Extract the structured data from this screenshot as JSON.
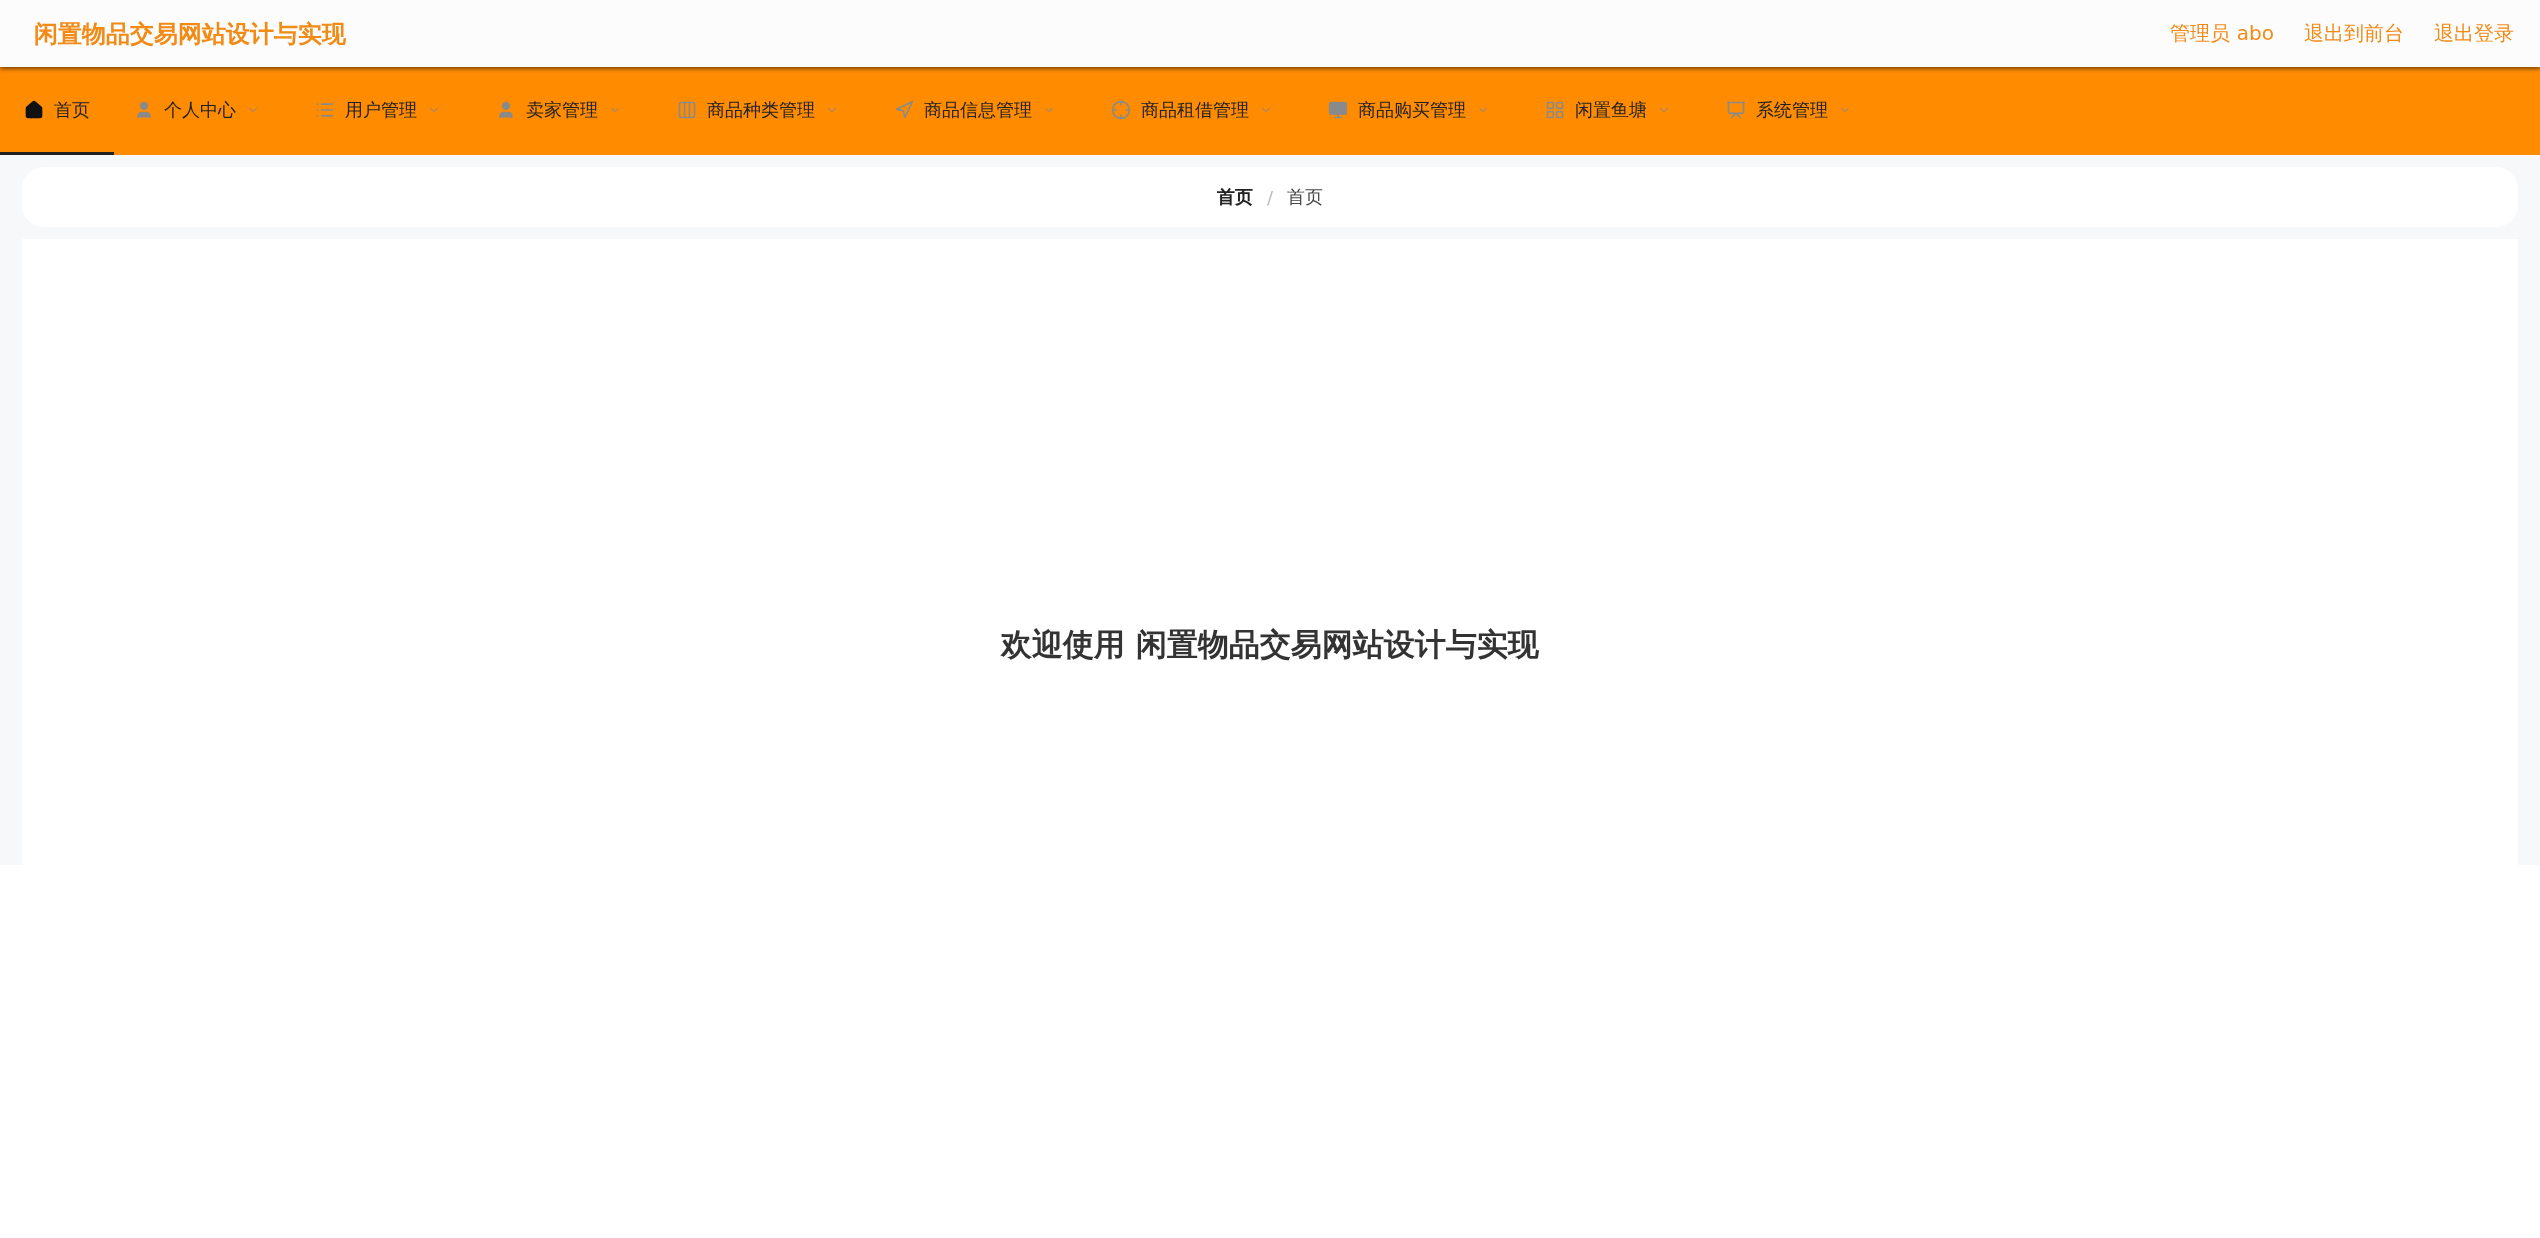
{
  "header": {
    "title": "闲置物品交易网站设计与实现",
    "links": [
      "管理员 abo",
      "退出到前台",
      "退出登录"
    ]
  },
  "nav": [
    {
      "label": "首页",
      "selected": true,
      "dropdown": false
    },
    {
      "label": "个人中心",
      "selected": false,
      "dropdown": true
    },
    {
      "label": "用户管理",
      "selected": false,
      "dropdown": true
    },
    {
      "label": "卖家管理",
      "selected": false,
      "dropdown": true
    },
    {
      "label": "商品种类管理",
      "selected": false,
      "dropdown": true
    },
    {
      "label": "商品信息管理",
      "selected": false,
      "dropdown": true
    },
    {
      "label": "商品租借管理",
      "selected": false,
      "dropdown": true
    },
    {
      "label": "商品购买管理",
      "selected": false,
      "dropdown": true
    },
    {
      "label": "闲置鱼塘",
      "selected": false,
      "dropdown": true
    },
    {
      "label": "系统管理",
      "selected": false,
      "dropdown": true
    }
  ],
  "breadcrumb": {
    "items": [
      "首页",
      "首页"
    ],
    "separator": "/"
  },
  "welcome": "欢迎使用 闲置物品交易网站设计与实现"
}
